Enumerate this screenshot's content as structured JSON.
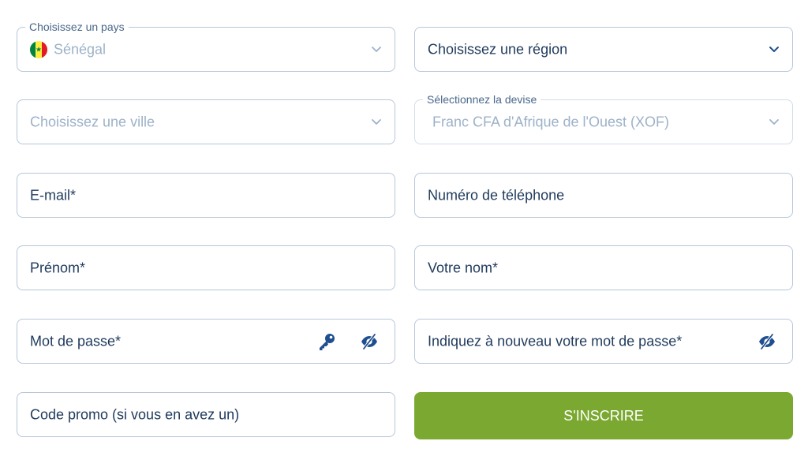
{
  "form": {
    "country": {
      "legend": "Choisissez un pays",
      "value": "Sénégal",
      "flag_colors": [
        "#00853f",
        "#fdef42",
        "#e31b23"
      ]
    },
    "region": {
      "placeholder": "Choisissez une région"
    },
    "city": {
      "placeholder": "Choisissez une ville"
    },
    "currency": {
      "legend": "Sélectionnez la devise",
      "value": "Franc CFA d'Afrique de l'Ouest (XOF)"
    },
    "email": {
      "placeholder": "E-mail*"
    },
    "phone": {
      "placeholder": "Numéro de téléphone"
    },
    "first_name": {
      "placeholder": "Prénom*"
    },
    "last_name": {
      "placeholder": "Votre nom*"
    },
    "password": {
      "placeholder": "Mot de passe*",
      "icons": [
        "key-icon",
        "eye-slash-icon"
      ]
    },
    "password_confirm": {
      "placeholder": "Indiquez à nouveau votre mot de passe*",
      "icons": [
        "eye-slash-icon"
      ]
    },
    "promo": {
      "placeholder": "Code promo (si vous en avez un)"
    },
    "submit_label": "S'INSCRIRE"
  },
  "colors": {
    "border": "#b7c7d8",
    "text": "#1f3a5c",
    "muted_text": "#9db2c8",
    "icon": "#1f4f8f",
    "button": "#7aa830",
    "button_text": "#ffffff"
  }
}
